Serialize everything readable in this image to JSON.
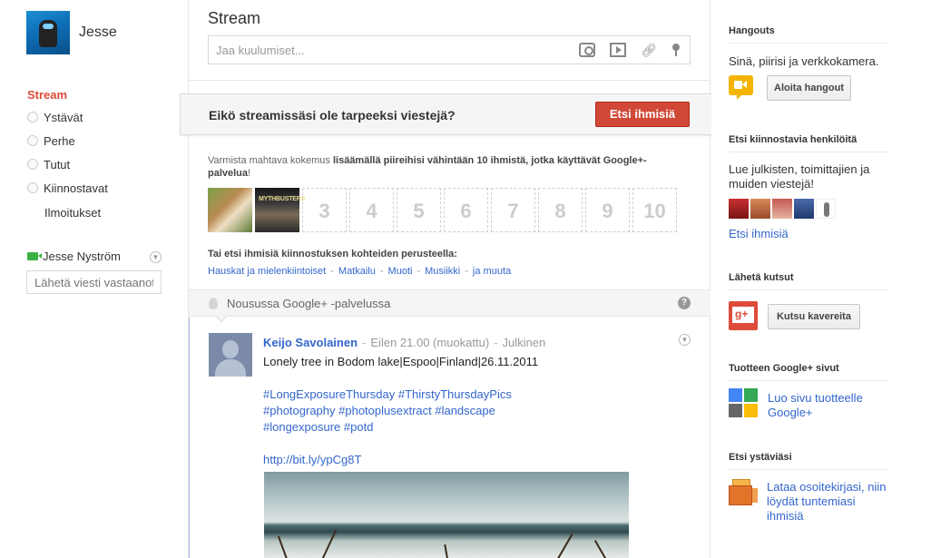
{
  "left": {
    "username": "Jesse",
    "stream_label": "Stream",
    "circles": [
      {
        "label": "Ystävät"
      },
      {
        "label": "Perhe"
      },
      {
        "label": "Tutut"
      },
      {
        "label": "Kiinnostavat"
      }
    ],
    "notifications_label": "Ilmoitukset",
    "chat_name": "Jesse Nyström",
    "chat_placeholder": "Lähetä viesti vastaanottajalle"
  },
  "center": {
    "title": "Stream",
    "share_placeholder": "Jaa kuulumiset...",
    "share_icons": [
      "camera-icon",
      "video-icon",
      "link-icon",
      "location-pin-icon"
    ],
    "prompt_question": "Eikö streamissäsi ole tarpeeksi viestejä?",
    "find_people_button": "Etsi ihmisiä",
    "suggest_prefix": "Varmista mahtava kokemus ",
    "suggest_bold": "lisäämällä piireihisi vähintään 10 ihmistä, jotka käyttävät Google+-palvelua",
    "suggest_suffix": "!",
    "slot_numbers": [
      "3",
      "4",
      "5",
      "6",
      "7",
      "8",
      "9",
      "10"
    ],
    "slot_photo2_caption": "MYTHBUSTERS",
    "interest_heading": "Tai etsi ihmisiä kiinnostuksen kohteiden perusteella:",
    "interest_links": [
      "Hauskat ja mielenkiintoiset",
      "Matkailu",
      "Muoti",
      "Musiikki",
      "ja muuta"
    ],
    "trending_label": "Nousussa Google+ -palvelussa",
    "post": {
      "author": "Keijo Savolainen",
      "time": "Eilen 21.00 (muokattu)",
      "visibility": "Julkinen",
      "text": "Lonely tree in Bodom lake|Espoo|Finland|26.11.2011",
      "hashtag_lines": [
        "#LongExposureThursday #ThirstyThursdayPics",
        "#photography #photoplusextract #landscape",
        "#longexposure #potd"
      ],
      "link": "http://bit.ly/ypCg8T"
    }
  },
  "right": {
    "hangouts_heading": "Hangouts",
    "hangouts_text": "Sinä, piirisi ja verkkokamera.",
    "hangouts_button": "Aloita hangout",
    "interesting_heading": "Etsi kiinnostavia henkilöitä",
    "interesting_text": "Lue julkisten, toimittajien ja muiden viestejä!",
    "interesting_link": "Etsi ihmisiä",
    "invite_heading": "Lähetä kutsut",
    "invite_button": "Kutsu kavereita",
    "pages_heading": "Tuotteen Google+ sivut",
    "pages_link": "Luo sivu tuotteelle Google+",
    "friends_heading": "Etsi ystäviäsi",
    "friends_link": "Lataa osoitekirjasi, niin löydät tuntemiasi ihmisiä"
  }
}
